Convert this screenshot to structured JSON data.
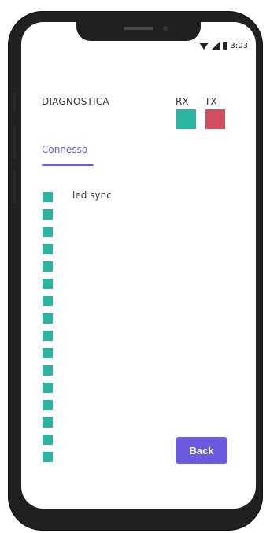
{
  "status_bar": {
    "time": "3:03",
    "icons": [
      "wifi-icon",
      "signal-icon",
      "battery-icon"
    ]
  },
  "header": {
    "title": "DIAGNOSTICA",
    "rx_label": "RX",
    "tx_label": "TX",
    "rx_color": "#2bb5a0",
    "tx_color": "#d24f62"
  },
  "tabs": [
    {
      "label": "Connesso",
      "active": true,
      "accent": "#6a5ae0"
    }
  ],
  "leds": {
    "count": 16,
    "color": "#2bb5a0",
    "first_label": "led sync"
  },
  "actions": {
    "back_label": "Back",
    "back_color": "#6a5ae0"
  }
}
